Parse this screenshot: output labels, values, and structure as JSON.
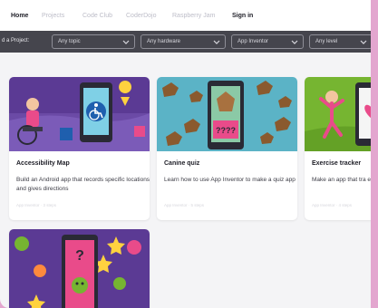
{
  "nav": {
    "items": [
      {
        "label": "Home",
        "active": true
      },
      {
        "label": "Projects",
        "active": false
      },
      {
        "label": "Code Club",
        "active": false
      },
      {
        "label": "CoderDojo",
        "active": false
      },
      {
        "label": "Raspberry Jam",
        "active": false
      },
      {
        "label": "Sign in",
        "active": true
      }
    ]
  },
  "filters": {
    "label": "d a Project:",
    "selects": [
      {
        "value": "Any topic"
      },
      {
        "value": "Any hardware"
      },
      {
        "value": "App Inventor"
      },
      {
        "value": "Any level"
      }
    ]
  },
  "cards": [
    {
      "title": "Accessibility Map",
      "description": "Build an Android app that records specific locations and gives directions",
      "meta": "App Inventor · 3 steps"
    },
    {
      "title": "Canine quiz",
      "description": "Learn how to use App Inventor to make a quiz app",
      "meta": "App Inventor · 5 steps"
    },
    {
      "title": "Exercise tracker",
      "description": "Make an app that tra exercise you do",
      "meta": "App Inventor · 4 steps"
    },
    {
      "title": "",
      "description": "",
      "meta": ""
    }
  ],
  "colors": {
    "frame_pink": "#e3a6cf",
    "filter_bar": "#45454d",
    "art_purple": "#5b3a94",
    "art_teal": "#5bb3c6",
    "art_green": "#76b531"
  }
}
